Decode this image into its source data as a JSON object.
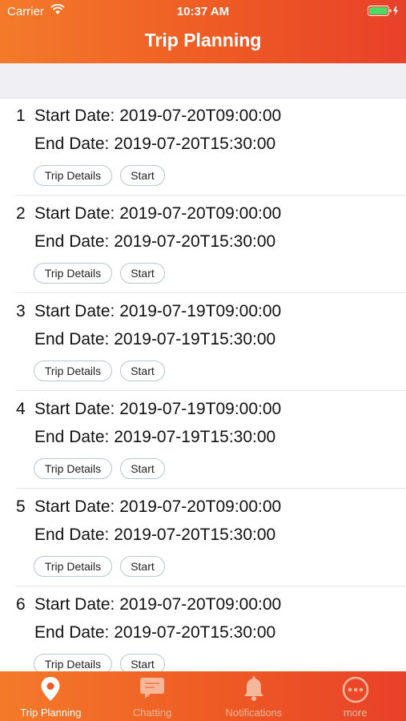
{
  "status_bar": {
    "carrier": "Carrier",
    "time": "10:37 AM"
  },
  "nav": {
    "title": "Trip Planning"
  },
  "trips": [
    {
      "index": "1",
      "start": "Start Date: 2019-07-20T09:00:00",
      "end": "End Date: 2019-07-20T15:30:00"
    },
    {
      "index": "2",
      "start": "Start Date: 2019-07-20T09:00:00",
      "end": "End Date: 2019-07-20T15:30:00"
    },
    {
      "index": "3",
      "start": "Start Date: 2019-07-19T09:00:00",
      "end": "End Date: 2019-07-19T15:30:00"
    },
    {
      "index": "4",
      "start": "Start Date: 2019-07-19T09:00:00",
      "end": "End Date: 2019-07-19T15:30:00"
    },
    {
      "index": "5",
      "start": "Start Date: 2019-07-20T09:00:00",
      "end": "End Date: 2019-07-20T15:30:00"
    },
    {
      "index": "6",
      "start": "Start Date: 2019-07-20T09:00:00",
      "end": "End Date: 2019-07-20T15:30:00"
    }
  ],
  "buttons": {
    "details_label": "Trip Details",
    "start_label": "Start"
  },
  "tabs": [
    {
      "label": "Trip Planning",
      "icon": "location-pin-icon",
      "active": true
    },
    {
      "label": "Chatting",
      "icon": "chat-bubble-icon",
      "active": false
    },
    {
      "label": "Notifications",
      "icon": "bell-icon",
      "active": false
    },
    {
      "label": "more",
      "icon": "more-dots-icon",
      "active": false
    }
  ],
  "colors": {
    "accent": "#ee5a24",
    "accent_light": "#f47a2a",
    "inactive_tab": "#f7b79a",
    "pill_border": "#b9c6d3"
  }
}
